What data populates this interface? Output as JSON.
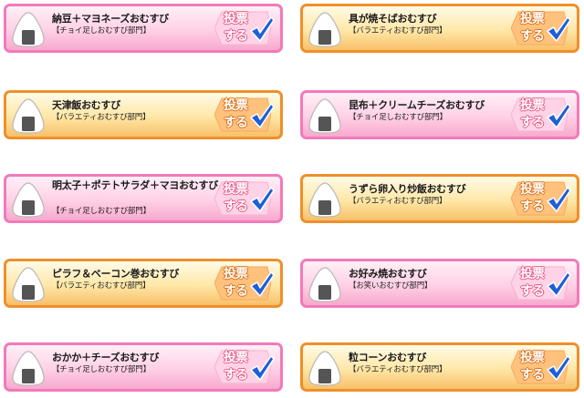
{
  "vote_button": {
    "line1": "投票",
    "line2": "する"
  },
  "icons": {
    "item_icon": "onigiri-icon",
    "vote_check": "check-icon"
  },
  "colors": {
    "pink_border": "#f27ab9",
    "orange_border": "#ef8f2a",
    "check": "#1e5fd8"
  },
  "cards": [
    {
      "title": "納豆＋マヨネーズおむすび",
      "category": "【チョイ足しおむすび部門】",
      "theme": "pink"
    },
    {
      "title": "具が焼そばおむすび",
      "category": "【バラエティおむすび部門】",
      "theme": "orange"
    },
    {
      "title": "天津飯おむすび",
      "category": "【バラエティおむすび部門】",
      "theme": "orange"
    },
    {
      "title": "昆布＋クリームチーズおむすび",
      "category": "【チョイ足しおむすび部門】",
      "theme": "pink"
    },
    {
      "title": "明太子＋ポテトサラダ＋マヨおむすび",
      "category": "【チョイ足しおむすび部門】",
      "theme": "pink"
    },
    {
      "title": "うずら卵入り炒飯おむすび",
      "category": "【バラエティおむすび部門】",
      "theme": "orange"
    },
    {
      "title": "ピラフ＆ベーコン巻おむすび",
      "category": "【バラエティおむすび部門】",
      "theme": "orange"
    },
    {
      "title": "お好み焼おむすび",
      "category": "【お笑いおむすび部門】",
      "theme": "pink"
    },
    {
      "title": "おかか＋チーズおむすび",
      "category": "【チョイ足しおむすび部門】",
      "theme": "pink"
    },
    {
      "title": "粒コーンおむすび",
      "category": "【バラエティおむすび部門】",
      "theme": "orange"
    }
  ]
}
